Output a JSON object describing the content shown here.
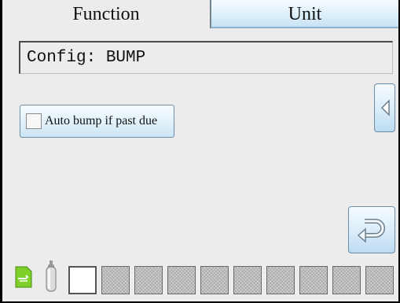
{
  "tabs": [
    {
      "label": "Function",
      "active": true
    },
    {
      "label": "Unit",
      "active": false
    }
  ],
  "config": {
    "text": "Config: BUMP"
  },
  "options": {
    "auto_bump_label": "Auto bump if past due",
    "auto_bump_checked": false
  },
  "buttons": {
    "prev_icon": "chevron-left-icon",
    "return_icon": "return-icon"
  },
  "status_bar": {
    "sd_icon": "sd-card-icon",
    "cylinder_icon": "gas-cylinder-icon",
    "slots": [
      "empty",
      "inactive",
      "inactive",
      "inactive",
      "inactive",
      "inactive",
      "inactive",
      "inactive",
      "inactive",
      "inactive"
    ]
  },
  "colors": {
    "button_blue": "#cbe4f5",
    "button_border": "#6d8ea8",
    "panel_bg": "#ececec",
    "sd_green": "#7fd12a"
  }
}
